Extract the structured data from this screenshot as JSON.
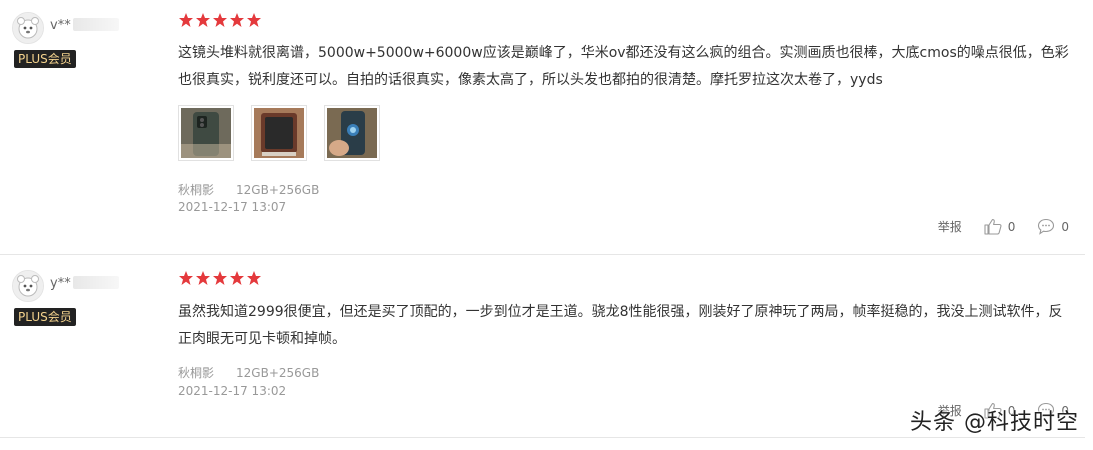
{
  "reviews": [
    {
      "user": {
        "name": "v**",
        "badge": "PLUS会员"
      },
      "rating": 5,
      "text": "这镜头堆料就很离谱，5000w+5000w+6000w应该是巅峰了，华米ov都还没有这么疯的组合。实测画质也很棒，大底cmos的噪点很低，色彩也很真实，锐利度还可以。自拍的话很真实，像素太高了，所以头发也都拍的很清楚。摩托罗拉这次太卷了，yyds",
      "images": [
        "phone-back-photo",
        "phone-box-photo",
        "phone-hand-photo"
      ],
      "color": "秋桐影",
      "spec": "12GB+256GB",
      "date": "2021-12-17 13:07",
      "report_label": "举报",
      "likes": "0",
      "comments": "0"
    },
    {
      "user": {
        "name": "y**",
        "badge": "PLUS会员"
      },
      "rating": 5,
      "text": "虽然我知道2999很便宜，但还是买了顶配的，一步到位才是王道。骁龙8性能很强，刚装好了原神玩了两局，帧率挺稳的，我没上测试软件，反正肉眼无可见卡顿和掉帧。",
      "color": "秋桐影",
      "spec": "12GB+256GB",
      "date": "2021-12-17 13:02",
      "report_label": "举报",
      "likes": "0",
      "comments": "0"
    }
  ],
  "watermark": "头条 @科技时空",
  "colors": {
    "star": "#e4393c",
    "badge_bg": "#222222",
    "badge_text": "#f3d28d"
  }
}
